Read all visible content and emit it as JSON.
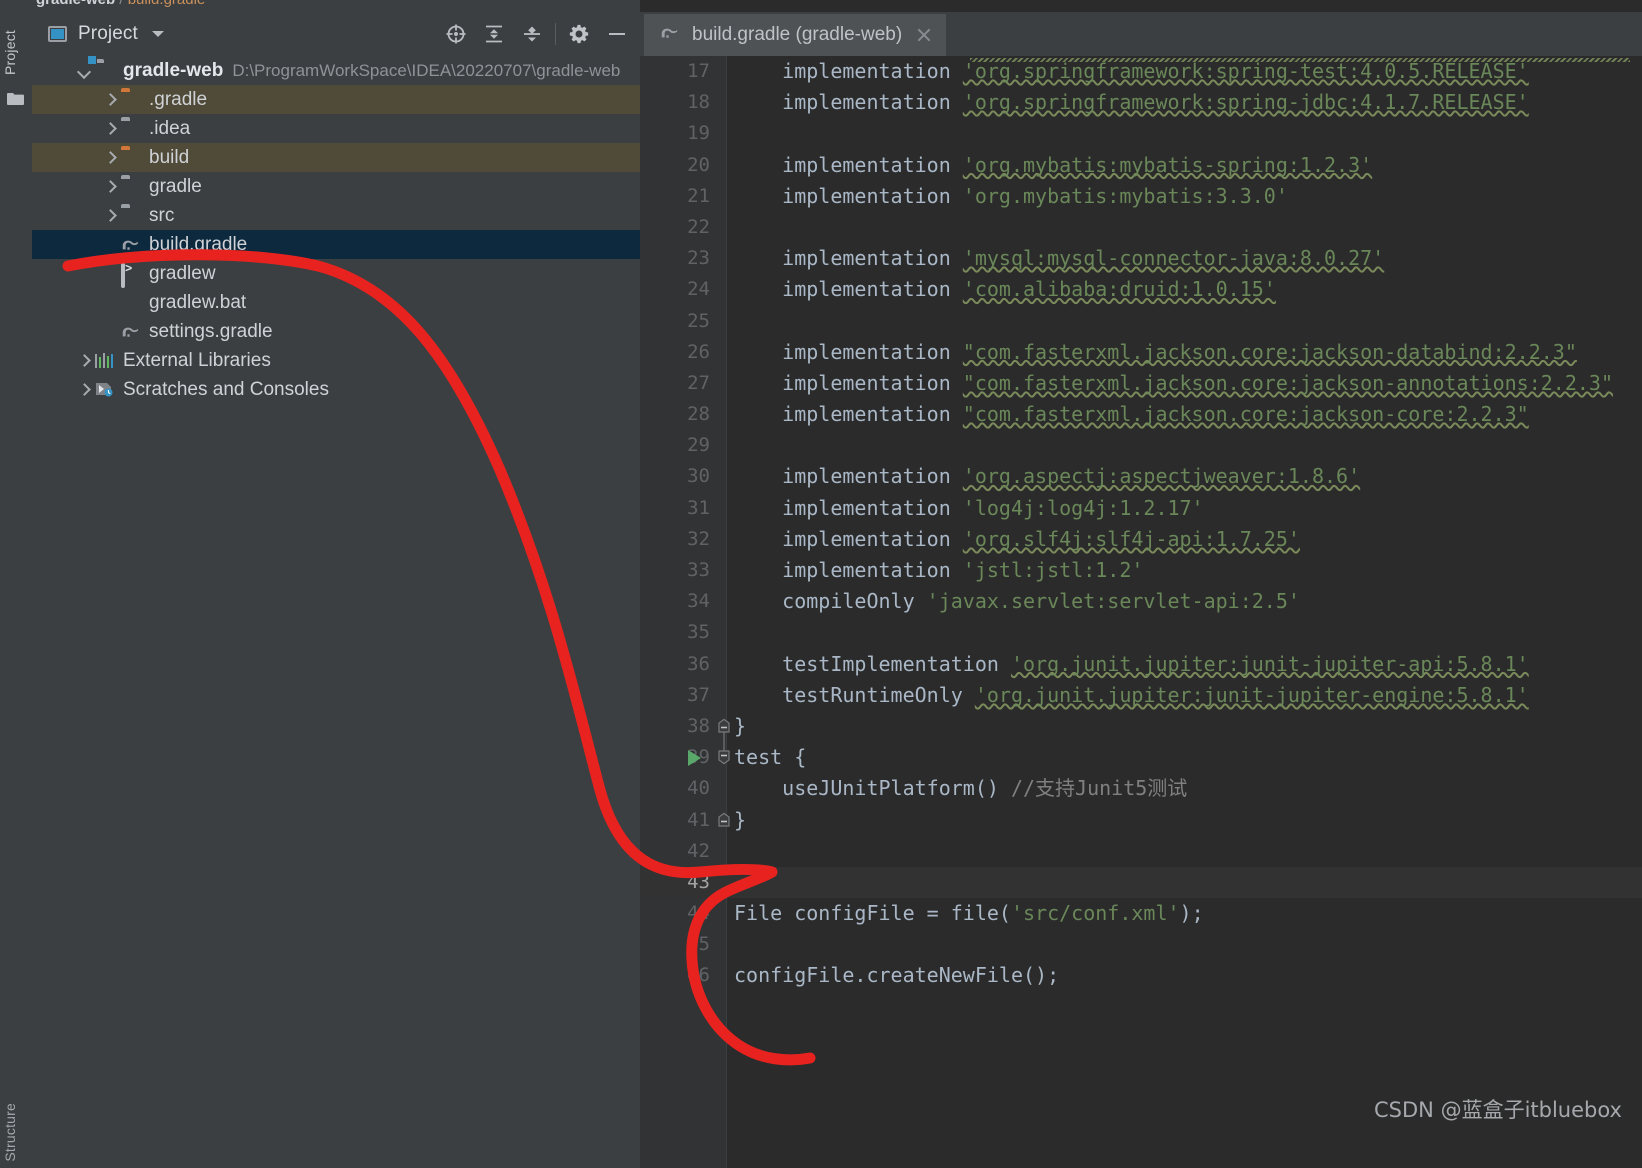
{
  "breadcrumb": {
    "project": "gradle-web",
    "separator": "/",
    "file": "build.gradle"
  },
  "toolwindows": {
    "left_top_label": "Project",
    "left_bottom_label": "Structure"
  },
  "project_panel": {
    "title": "Project",
    "actions": [
      {
        "name": "select-opened-file-icon",
        "label": "Select Opened File"
      },
      {
        "name": "expand-all-icon",
        "label": "Expand All"
      },
      {
        "name": "collapse-all-icon",
        "label": "Collapse All"
      },
      {
        "name": "settings-gear-icon",
        "label": "Settings"
      },
      {
        "name": "hide-icon",
        "label": "Hide"
      }
    ],
    "tree": [
      {
        "label": "gradle-web",
        "path": "D:\\ProgramWorkSpace\\IDEA\\20220707\\gradle-web",
        "icon": "module-icon",
        "twist": "open",
        "indent": 0,
        "bold": true,
        "state": "normal"
      },
      {
        "label": ".gradle",
        "path": "",
        "icon": "folder-orange-icon",
        "twist": "closed",
        "indent": 1,
        "bold": false,
        "state": "highlight"
      },
      {
        "label": ".idea",
        "path": "",
        "icon": "folder-gray-icon",
        "twist": "closed",
        "indent": 1,
        "bold": false,
        "state": "normal"
      },
      {
        "label": "build",
        "path": "",
        "icon": "folder-orange-icon",
        "twist": "closed",
        "indent": 1,
        "bold": false,
        "state": "highlight"
      },
      {
        "label": "gradle",
        "path": "",
        "icon": "folder-gray-icon",
        "twist": "closed",
        "indent": 1,
        "bold": false,
        "state": "normal"
      },
      {
        "label": "src",
        "path": "",
        "icon": "folder-gray-icon",
        "twist": "closed",
        "indent": 1,
        "bold": false,
        "state": "normal"
      },
      {
        "label": "build.gradle",
        "path": "",
        "icon": "gradle-file-icon",
        "twist": "none",
        "indent": 1,
        "bold": false,
        "state": "selected"
      },
      {
        "label": "gradlew",
        "path": "",
        "icon": "shell-script-icon",
        "twist": "none",
        "indent": 1,
        "bold": false,
        "state": "normal"
      },
      {
        "label": "gradlew.bat",
        "path": "",
        "icon": "bat-file-icon",
        "twist": "none",
        "indent": 1,
        "bold": false,
        "state": "normal"
      },
      {
        "label": "settings.gradle",
        "path": "",
        "icon": "gradle-file-icon",
        "twist": "none",
        "indent": 1,
        "bold": false,
        "state": "normal"
      },
      {
        "label": "External Libraries",
        "path": "",
        "icon": "external-libraries-icon",
        "twist": "closed",
        "indent": 0,
        "bold": false,
        "state": "normal"
      },
      {
        "label": "Scratches and Consoles",
        "path": "",
        "icon": "scratches-icon",
        "twist": "closed",
        "indent": 0,
        "bold": false,
        "state": "normal"
      }
    ]
  },
  "editor": {
    "tabs": [
      {
        "label": "build.gradle (gradle-web)",
        "icon": "gradle-file-icon",
        "active": true,
        "closable": true
      }
    ],
    "current_line": 43,
    "lines": [
      {
        "n": 17,
        "segments": [
          {
            "t": "    implementation ",
            "c": "kw"
          },
          {
            "t": "'org.springframework:spring-test:4.0.5.RELEASE'",
            "c": "str-u"
          }
        ]
      },
      {
        "n": 18,
        "segments": [
          {
            "t": "    implementation ",
            "c": "kw"
          },
          {
            "t": "'org.springframework:spring-jdbc:4.1.7.RELEASE'",
            "c": "str-u"
          }
        ]
      },
      {
        "n": 19,
        "segments": []
      },
      {
        "n": 20,
        "segments": [
          {
            "t": "    implementation ",
            "c": "kw"
          },
          {
            "t": "'org.mybatis:mybatis-spring:1.2.3'",
            "c": "str-u"
          }
        ]
      },
      {
        "n": 21,
        "segments": [
          {
            "t": "    implementation ",
            "c": "kw"
          },
          {
            "t": "'org.mybatis:mybatis:3.3.0'",
            "c": "str"
          }
        ]
      },
      {
        "n": 22,
        "segments": []
      },
      {
        "n": 23,
        "segments": [
          {
            "t": "    implementation ",
            "c": "kw"
          },
          {
            "t": "'mysql:mysql-connector-java:8.0.27'",
            "c": "str-u"
          }
        ]
      },
      {
        "n": 24,
        "segments": [
          {
            "t": "    implementation ",
            "c": "kw"
          },
          {
            "t": "'com.alibaba:druid:1.0.15'",
            "c": "str-u"
          }
        ]
      },
      {
        "n": 25,
        "segments": []
      },
      {
        "n": 26,
        "segments": [
          {
            "t": "    implementation ",
            "c": "kw"
          },
          {
            "t": "\"com.fasterxml.jackson.core:jackson-databind:2.2.3\"",
            "c": "str-u"
          }
        ]
      },
      {
        "n": 27,
        "segments": [
          {
            "t": "    implementation ",
            "c": "kw"
          },
          {
            "t": "\"com.fasterxml.jackson.core:jackson-annotations:2.2.3\"",
            "c": "str-u"
          }
        ]
      },
      {
        "n": 28,
        "segments": [
          {
            "t": "    implementation ",
            "c": "kw"
          },
          {
            "t": "\"com.fasterxml.jackson.core:jackson-core:2.2.3\"",
            "c": "str-u"
          }
        ]
      },
      {
        "n": 29,
        "segments": []
      },
      {
        "n": 30,
        "segments": [
          {
            "t": "    implementation ",
            "c": "kw"
          },
          {
            "t": "'org.aspectj:aspectjweaver:1.8.6'",
            "c": "str-u"
          }
        ]
      },
      {
        "n": 31,
        "segments": [
          {
            "t": "    implementation ",
            "c": "kw"
          },
          {
            "t": "'log4j:log4j:1.2.17'",
            "c": "str"
          }
        ]
      },
      {
        "n": 32,
        "segments": [
          {
            "t": "    implementation ",
            "c": "kw"
          },
          {
            "t": "'org.slf4j:slf4j-api:1.7.25'",
            "c": "str-u"
          }
        ]
      },
      {
        "n": 33,
        "segments": [
          {
            "t": "    implementation ",
            "c": "kw"
          },
          {
            "t": "'jstl:jstl:1.2'",
            "c": "str"
          }
        ]
      },
      {
        "n": 34,
        "segments": [
          {
            "t": "    compileOnly ",
            "c": "kw"
          },
          {
            "t": "'javax.servlet:servlet-api:2.5'",
            "c": "str"
          }
        ]
      },
      {
        "n": 35,
        "segments": []
      },
      {
        "n": 36,
        "segments": [
          {
            "t": "    testImplementation ",
            "c": "kw"
          },
          {
            "t": "'org.junit.jupiter:junit-jupiter-api:5.8.1'",
            "c": "str-u"
          }
        ]
      },
      {
        "n": 37,
        "segments": [
          {
            "t": "    testRuntimeOnly ",
            "c": "kw"
          },
          {
            "t": "'org.junit.jupiter:junit-jupiter-engine:5.8.1'",
            "c": "str-u"
          }
        ]
      },
      {
        "n": 38,
        "segments": [
          {
            "t": "}",
            "c": "punc"
          }
        ]
      },
      {
        "n": 39,
        "segments": [
          {
            "t": "test {",
            "c": "kw"
          }
        ]
      },
      {
        "n": 40,
        "segments": [
          {
            "t": "    useJUnitPlatform() ",
            "c": "kw"
          },
          {
            "t": "//支持Junit5测试",
            "c": "cmt"
          }
        ]
      },
      {
        "n": 41,
        "segments": [
          {
            "t": "}",
            "c": "punc"
          }
        ]
      },
      {
        "n": 42,
        "segments": []
      },
      {
        "n": 43,
        "segments": []
      },
      {
        "n": 44,
        "segments": [
          {
            "t": "File configFile = file(",
            "c": "plain"
          },
          {
            "t": "'src/conf.xml'",
            "c": "str"
          },
          {
            "t": ");",
            "c": "plain"
          }
        ]
      },
      {
        "n": 45,
        "segments": []
      },
      {
        "n": 46,
        "segments": [
          {
            "t": "configFile.createNewFile();",
            "c": "plain"
          }
        ]
      }
    ],
    "gutter_markers": [
      {
        "line": 38,
        "type": "fold-end-icon"
      },
      {
        "line": 39,
        "type": "run-gradle-task-icon"
      },
      {
        "line": 39,
        "type": "fold-start-icon"
      },
      {
        "line": 41,
        "type": "fold-end-icon"
      }
    ]
  },
  "annotation": {
    "type": "red-freehand-stroke",
    "color": "#e8231f"
  },
  "watermark": {
    "text": "CSDN @蓝盒子itbluebox"
  },
  "colors": {
    "panel_bg": "#3c3f41",
    "editor_bg": "#2b2b2b",
    "gutter_bg": "#313335",
    "selection_bg": "#0d293e",
    "highlight_row_bg": "#504b38",
    "keyword": "#a9b7c6",
    "string": "#6a8759",
    "comment": "#808080",
    "line_number": "#606366",
    "accent": "#3592c4",
    "folder_orange": "#d2773a",
    "run_green": "#59a869"
  }
}
